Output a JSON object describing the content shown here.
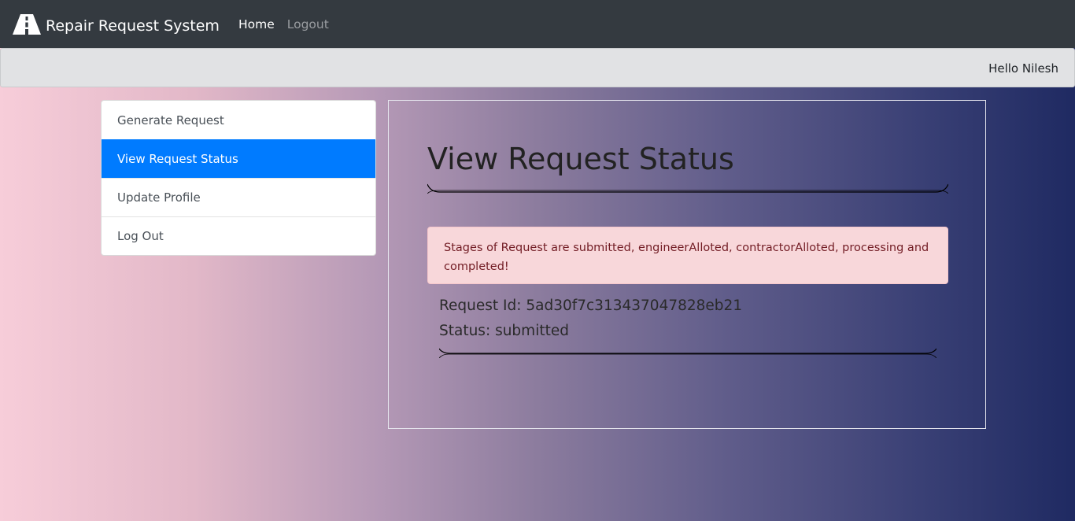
{
  "navbar": {
    "brand": "Repair Request System",
    "links": [
      {
        "label": "Home"
      },
      {
        "label": "Logout"
      }
    ]
  },
  "subbar": {
    "greeting": "Hello Nilesh"
  },
  "menu": {
    "items": [
      {
        "label": "Generate Request"
      },
      {
        "label": "View Request Status"
      },
      {
        "label": "Update Profile"
      },
      {
        "label": "Log Out"
      }
    ]
  },
  "main": {
    "title": "View Request Status",
    "alert": "Stages of Request are submitted, engineerAlloted, contractorAlloted, processing and completed!",
    "request": {
      "id_text": "Request Id: 5ad30f7c313437047828eb21",
      "status_text": "Status: submitted"
    }
  },
  "icons": {
    "brand": "road-icon"
  },
  "colors": {
    "active": "#007bff",
    "navbar": "#343a40",
    "alert_bg": "#f8d7da",
    "alert_text": "#721c24"
  }
}
